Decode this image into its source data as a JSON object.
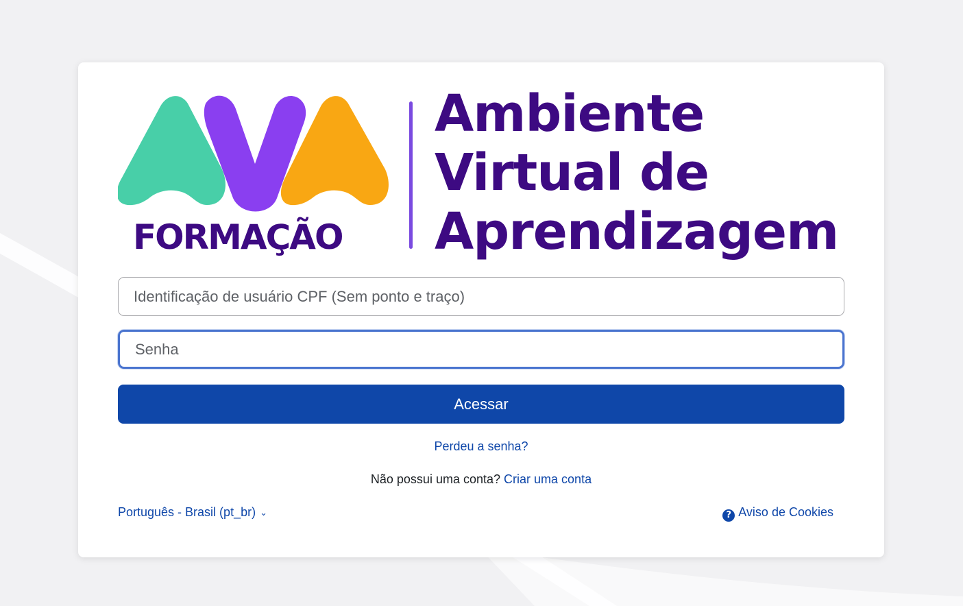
{
  "logo": {
    "mark_text": "AVA",
    "subtitle": "FORMAÇÃO",
    "title_lines": [
      "Ambiente",
      "Virtual de",
      "Aprendizagem"
    ],
    "colors": {
      "green": "#48cfa8",
      "purple": "#8a3ff0",
      "orange": "#f9a713",
      "dark_purple": "#3d0a82",
      "divider": "#7a4ae0"
    }
  },
  "form": {
    "username_placeholder": "Identificação de usuário CPF (Sem ponto e traço)",
    "username_value": "",
    "password_placeholder": "Senha",
    "password_value": "",
    "submit_label": "Acessar",
    "forgot_link": "Perdeu a senha?",
    "signup_prompt": "Não possui uma conta?",
    "signup_link": "Criar uma conta"
  },
  "footer": {
    "language": "Português - Brasil (pt_br)",
    "language_icon": "chevron-down-icon",
    "cookies_label": "Aviso de Cookies",
    "cookies_icon": "question-circle-icon"
  },
  "theme": {
    "primary": "#0f47a9",
    "focus_border": "#4a74cf",
    "background": "#f1f1f3"
  }
}
